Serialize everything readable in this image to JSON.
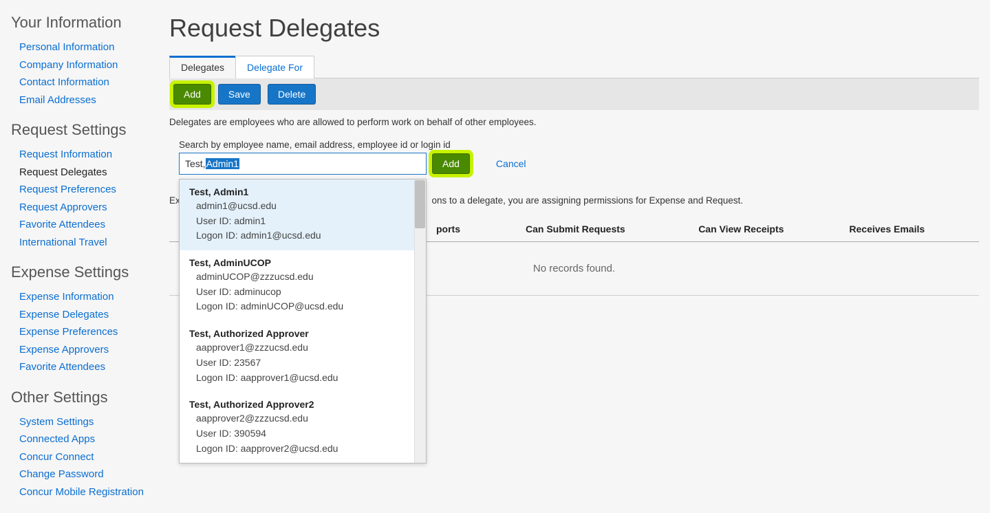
{
  "sidebar": {
    "groups": [
      {
        "title": "Your Information",
        "links": [
          {
            "label": "Personal Information",
            "active": false
          },
          {
            "label": "Company Information",
            "active": false
          },
          {
            "label": "Contact Information",
            "active": false
          },
          {
            "label": "Email Addresses",
            "active": false
          }
        ]
      },
      {
        "title": "Request Settings",
        "links": [
          {
            "label": "Request Information",
            "active": false
          },
          {
            "label": "Request Delegates",
            "active": true
          },
          {
            "label": "Request Preferences",
            "active": false
          },
          {
            "label": "Request Approvers",
            "active": false
          },
          {
            "label": "Favorite Attendees",
            "active": false
          },
          {
            "label": "International Travel",
            "active": false
          }
        ]
      },
      {
        "title": "Expense Settings",
        "links": [
          {
            "label": "Expense Information",
            "active": false
          },
          {
            "label": "Expense Delegates",
            "active": false
          },
          {
            "label": "Expense Preferences",
            "active": false
          },
          {
            "label": "Expense Approvers",
            "active": false
          },
          {
            "label": "Favorite Attendees",
            "active": false
          }
        ]
      },
      {
        "title": "Other Settings",
        "links": [
          {
            "label": "System Settings",
            "active": false
          },
          {
            "label": "Connected Apps",
            "active": false
          },
          {
            "label": "Concur Connect",
            "active": false
          },
          {
            "label": "Change Password",
            "active": false
          },
          {
            "label": "Concur Mobile Registration",
            "active": false
          }
        ]
      }
    ]
  },
  "main": {
    "title": "Request Delegates",
    "tabs": [
      {
        "label": "Delegates",
        "active": true
      },
      {
        "label": "Delegate For",
        "active": false
      }
    ],
    "toolbar": {
      "add": "Add",
      "save": "Save",
      "delete": "Delete"
    },
    "info": "Delegates are employees who are allowed to perform work on behalf of other employees.",
    "search": {
      "label": "Search by employee name, email address, employee id or login id",
      "prefix": "Test,",
      "selected": " Admin1",
      "add": "Add",
      "cancel": "Cancel"
    },
    "dropdown": [
      {
        "name": "Test, Admin1",
        "email": "admin1@ucsd.edu",
        "userid": "User ID: admin1",
        "logon": "Logon ID: admin1@ucsd.edu",
        "hl": true
      },
      {
        "name": "Test, AdminUCOP",
        "email": "adminUCOP@zzzucsd.edu",
        "userid": "User ID: adminucop",
        "logon": "Logon ID: adminUCOP@ucsd.edu",
        "hl": false
      },
      {
        "name": "Test, Authorized Approver",
        "email": "aapprover1@zzzucsd.edu",
        "userid": "User ID: 23567",
        "logon": "Logon ID: aapprover1@ucsd.edu",
        "hl": false
      },
      {
        "name": "Test, Authorized Approver2",
        "email": "aapprover2@zzzucsd.edu",
        "userid": "User ID: 390594",
        "logon": "Logon ID: aapprover2@ucsd.edu",
        "hl": false
      }
    ],
    "assign_text_prefix": "Ex",
    "assign_text_suffix": "ons to a delegate, you are assigning permissions for Expense and Request.",
    "columns_first_suffix": "ports",
    "columns": [
      "Can Submit Requests",
      "Can View Receipts",
      "Receives Emails"
    ],
    "no_records": "No records found."
  }
}
